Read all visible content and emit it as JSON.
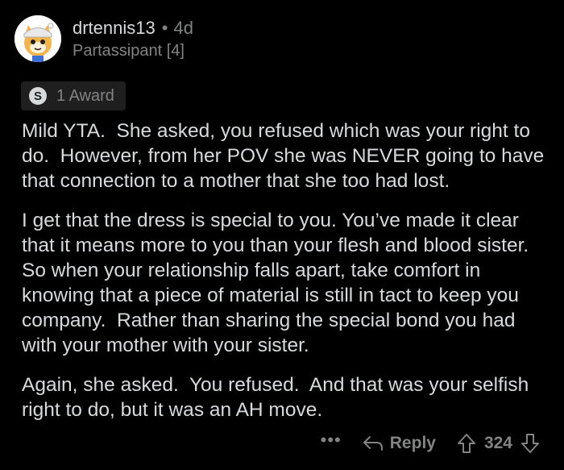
{
  "comment": {
    "author": {
      "username": "drtennis13",
      "separator": "•",
      "age": "4d",
      "flair": "Partassipant [4]",
      "avatar_icon": "snoo-avatar-icon"
    },
    "award": {
      "icon": "award-coin-icon",
      "icon_glyph": "S",
      "label": "1 Award"
    },
    "paragraphs": [
      "Mild YTA.  She asked, you refused which was your right to do.  However, from her POV she was NEVER going to have that connection to a mother that she too had lost.",
      "I get that the dress is special to you. You’ve made it clear that it means more to you than your flesh and blood sister.  So when your relationship falls apart, take comfort in knowing that a piece of material is still in tact to keep you company.  Rather than sharing the special bond you had with your mother with your sister.",
      "Again, she asked.  You refused.  And that was your selfish right to do, but it was an AH move."
    ],
    "actions": {
      "more_label": "•••",
      "reply_label": "Reply",
      "reply_icon": "reply-arrow-icon",
      "upvote_icon": "upvote-arrow-icon",
      "downvote_icon": "downvote-arrow-icon",
      "score": "324"
    }
  },
  "colors": {
    "background": "#000000",
    "text_primary": "#d7dadc",
    "text_secondary": "#818384",
    "award_background": "#1f1f20"
  }
}
